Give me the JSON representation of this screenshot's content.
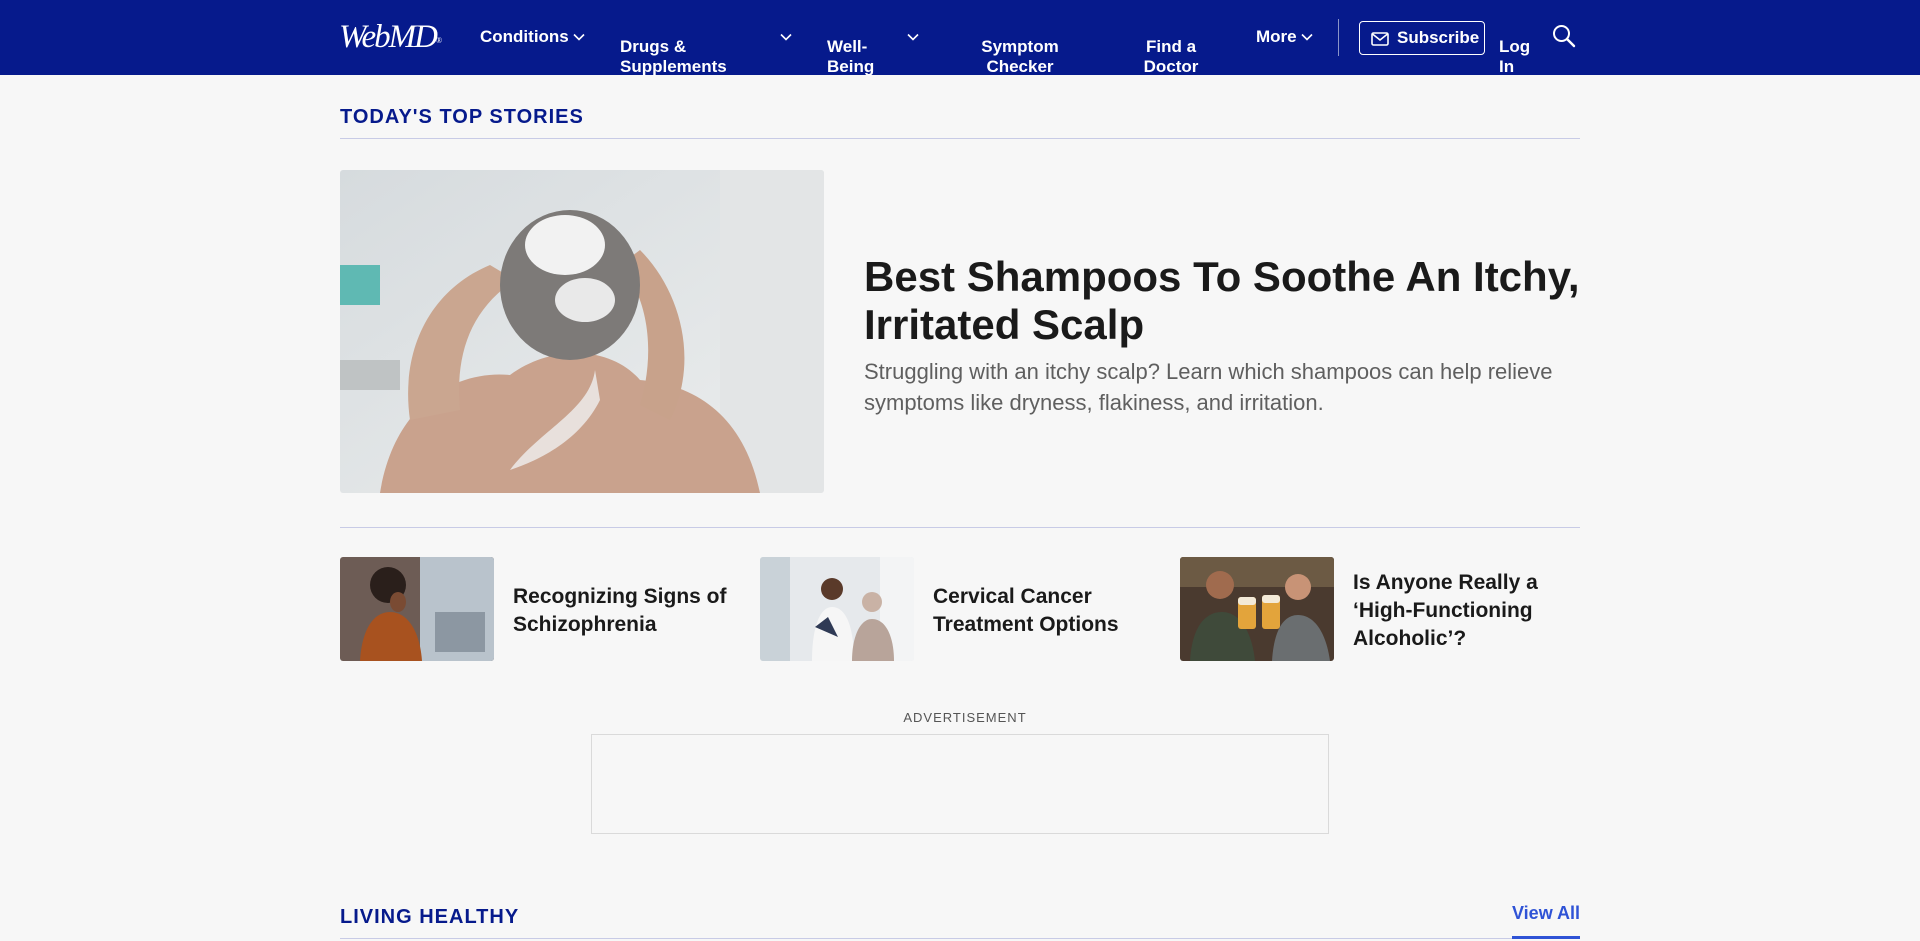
{
  "header": {
    "logo": "WebMD",
    "nav": [
      {
        "label": "Conditions"
      },
      {
        "label": "Drugs &\nSupplements"
      },
      {
        "label": "Well-\nBeing"
      },
      {
        "label": "Symptom\nChecker"
      },
      {
        "label": "Find a\nDoctor"
      },
      {
        "label": "More"
      }
    ],
    "subscribe_label": "Subscribe",
    "login_label": "Log\nIn"
  },
  "top_stories": {
    "title": "TODAY'S TOP STORIES",
    "hero": {
      "title": "Best Shampoos To Soothe An Itchy, Irritated Scalp",
      "description": "Struggling with an itchy scalp? Learn which shampoos can help relieve symptoms like dryness, flakiness, and irritation."
    },
    "cards": [
      {
        "title": "Recognizing Signs of Schizophrenia"
      },
      {
        "title": "Cervical Cancer Treatment Options"
      },
      {
        "title": "Is Anyone Really a ‘High-Functioning Alcoholic’?"
      }
    ]
  },
  "ad": {
    "label": "ADVERTISEMENT"
  },
  "living_healthy": {
    "title": "LIVING HEALTHY",
    "view_all": "View All"
  },
  "colors": {
    "header_bg": "#061a8c",
    "section_title": "#061a8c",
    "link": "#2f53d6",
    "page_bg": "#f7f7f7"
  },
  "icons": [
    "chevron-down-icon",
    "mail-icon",
    "search-icon"
  ]
}
